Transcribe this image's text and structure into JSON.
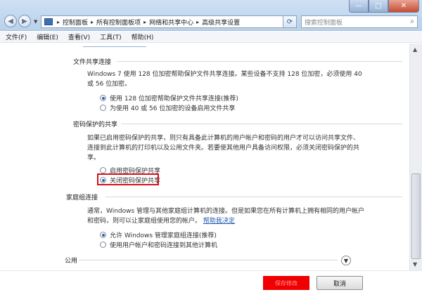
{
  "window": {
    "minimize": "—",
    "maximize": "□",
    "close": "✕"
  },
  "address": {
    "crumbs": [
      "控制面板",
      "所有控制面板项",
      "网络和共享中心",
      "高级共享设置"
    ]
  },
  "search": {
    "placeholder": "搜索控制面板"
  },
  "menu": {
    "file": "文件(F)",
    "edit": "编辑(E)",
    "view": "查看(V)",
    "tools": "工具(T)",
    "help": "帮助(H)"
  },
  "file_sharing": {
    "title": "文件共享连接",
    "desc_line1": "Windows 7 使用 128 位加密帮助保护文件共享连接。某些设备不支持 128 位加密，必须使用 40",
    "desc_line2": "或 56 位加密。",
    "option1": "使用 128 位加密帮助保护文件共享连接(推荐)",
    "option2": "为使用 40 或 56 位加密的设备启用文件共享",
    "selected": 1
  },
  "password_sharing": {
    "title": "密码保护的共享",
    "desc_line1": "如果已启用密码保护的共享，则只有具备此计算机的用户帐户和密码的用户才可以访问共享文件、",
    "desc_line2": "连接到此计算机的打印机以及公用文件夹。若要使其他用户具备访问权限，必须关闭密码保护的共",
    "desc_line3": "享。",
    "option1": "启用密码保护共享",
    "option2": "关闭密码保护共享",
    "selected": 2
  },
  "homegroup": {
    "title": "家庭组连接",
    "desc_line1": "通常，Windows 管理与其他家庭组计算机的连接。但是如果您在所有计算机上拥有相同的用户帐户",
    "desc_line2": "和密码，则可以让家庭组使用您的帐户。",
    "help_link": "帮助我决定",
    "option1": "允许 Windows 管理家庭组连接(推荐)",
    "option2": "使用用户帐户和密码连接到其他计算机",
    "selected": 1
  },
  "public": {
    "title": "公用"
  },
  "buttons": {
    "save": "保存修改",
    "cancel": "取消"
  },
  "colors": {
    "highlight": "#d4111b",
    "save_button": "#f00000",
    "link": "#1c5ab0"
  }
}
